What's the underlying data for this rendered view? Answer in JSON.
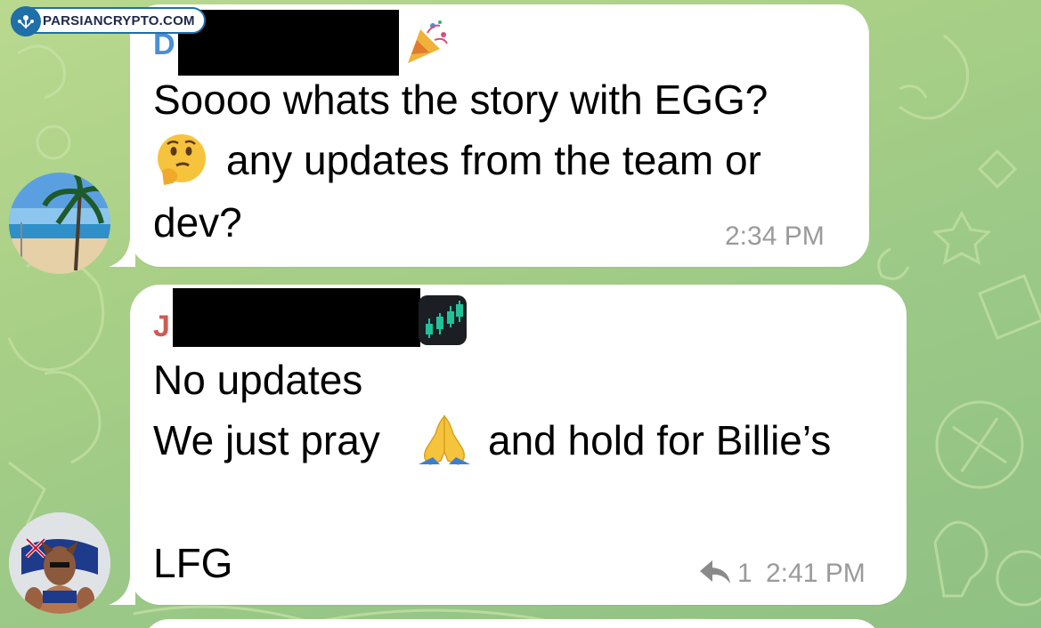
{
  "watermark": {
    "text": "PARSIANCRYPTO.COM"
  },
  "messages": [
    {
      "sender_initial": "D",
      "sender_color": "#4a8fd6",
      "badge_icon": "party-popper-icon",
      "lines": [
        "Soooo whats the story with EGG?",
        "any updates from the team or",
        "dev?"
      ],
      "thinking_emoji": "thinking-face-icon",
      "time": "2:34 PM"
    },
    {
      "sender_initial": "J",
      "sender_color": "#cf5a55",
      "badge_icon": "candlestick-chart-icon",
      "lines": [
        "No updates",
        "We just pray",
        "and hold for Billie’s",
        "LFG"
      ],
      "pray_emoji": "folded-hands-icon",
      "reply_count": "1",
      "time": "2:41 PM"
    }
  ]
}
